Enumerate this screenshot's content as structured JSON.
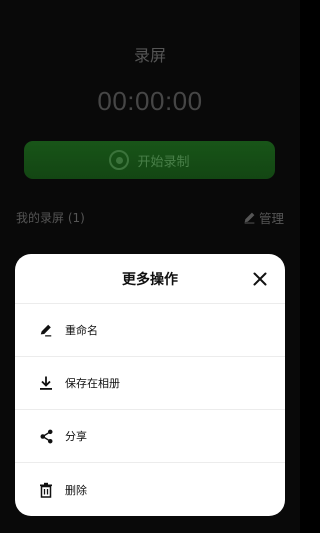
{
  "screen": {
    "title": "录屏",
    "timer": "00:00:00",
    "start_button_label": "开始录制",
    "recordings_title": "我的录屏 (1)",
    "manage_label": "管理"
  },
  "sheet": {
    "title": "更多操作",
    "items": [
      {
        "label": "重命名",
        "icon": "pencil-icon"
      },
      {
        "label": "保存在相册",
        "icon": "download-icon"
      },
      {
        "label": "分享",
        "icon": "share-icon"
      },
      {
        "label": "删除",
        "icon": "trash-icon"
      }
    ]
  },
  "colors": {
    "accent_green": "#1a5a1a",
    "sheet_bg": "#ffffff",
    "background": "#0a0a0a"
  }
}
